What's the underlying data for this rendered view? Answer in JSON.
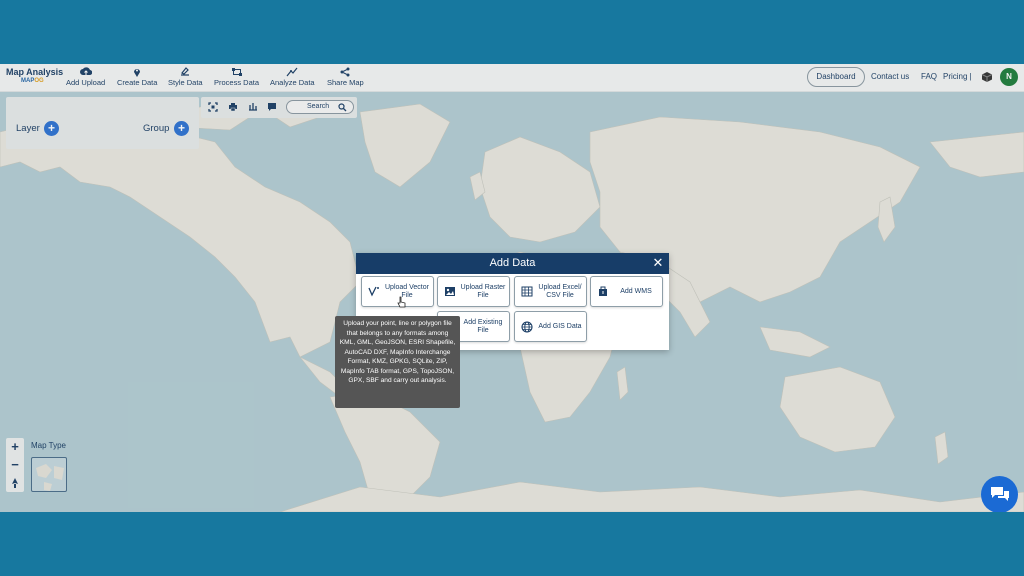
{
  "brand": {
    "title": "Map Analysis",
    "logo_main": "MAP",
    "logo_accent": "OG"
  },
  "nav": [
    {
      "label": "Add Upload",
      "icon": "cloud-upload-icon"
    },
    {
      "label": "Create Data",
      "icon": "map-pin-icon"
    },
    {
      "label": "Style Data",
      "icon": "paint-icon"
    },
    {
      "label": "Process Data",
      "icon": "process-icon"
    },
    {
      "label": "Analyze Data",
      "icon": "analyze-icon"
    },
    {
      "label": "Share Map",
      "icon": "share-icon"
    }
  ],
  "header_right": {
    "dashboard": "Dashboard",
    "contact": "Contact us",
    "faq": "FAQ",
    "pricing": "Pricing |",
    "avatar_letter": "N"
  },
  "layer_panel": {
    "layer_label": "Layer",
    "group_label": "Group",
    "plus": "+"
  },
  "toolbar": {
    "search_label": "Search"
  },
  "map_controls": {
    "zoom_in": "+",
    "zoom_out": "−",
    "map_type_label": "Map Type"
  },
  "modal": {
    "title": "Add Data",
    "close": "✕",
    "options": [
      {
        "label": "Upload Vector File",
        "icon": "vector-icon"
      },
      {
        "label": "Upload Raster File",
        "icon": "raster-icon"
      },
      {
        "label": "Upload Excel/ CSV File",
        "icon": "spreadsheet-icon"
      },
      {
        "label": "Add WMS",
        "icon": "wms-icon"
      },
      {
        "label": "Add Existing File",
        "icon": "file-icon"
      },
      {
        "label": "Add GIS Data",
        "icon": "globe-icon"
      }
    ]
  },
  "tooltip": {
    "text": "Upload your point, line or polygon file that belongs to any formats among KML, GML, GeoJSON, ESRI Shapefile, AutoCAD DXF, MapInfo Interchange Format, KMZ, GPKG, SQLite, ZIP, MapInfo TAB format, GPS, TopoJSON, GPX, SBF and carry out analysis."
  },
  "colors": {
    "frame": "#17789f",
    "header_navy": "#173d68",
    "accent_blue": "#2e72d2",
    "ocean": "#b3cdd4",
    "land": "#e8e6de"
  }
}
